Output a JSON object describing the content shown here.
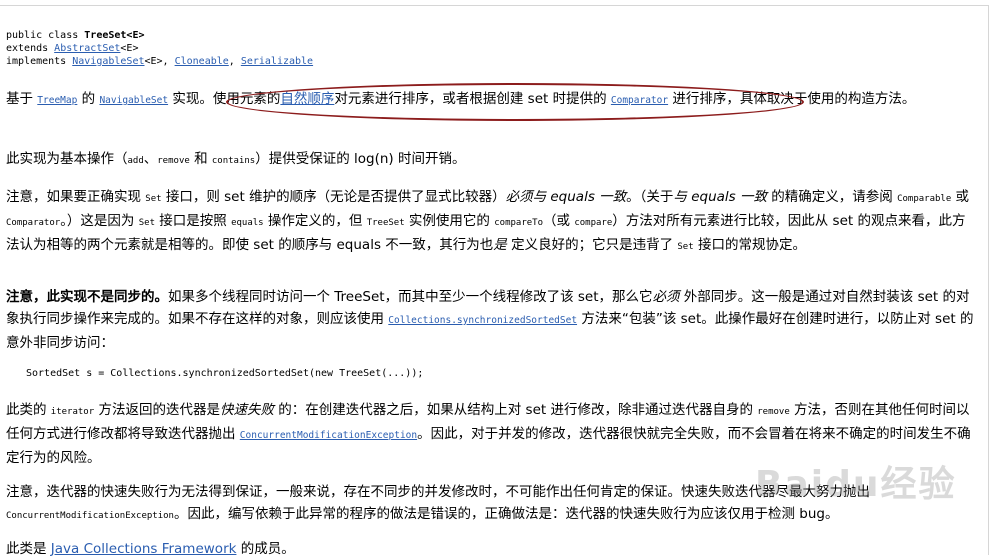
{
  "decl": {
    "l1_prefix": "public class ",
    "class_name": "TreeSet<E>",
    "l2_prefix": "extends ",
    "extends_link": "AbstractSet",
    "extends_suffix": "<E>",
    "l3_prefix": "implements ",
    "impl1": "NavigableSet",
    "impl1_suffix": "<E>, ",
    "impl2": "Cloneable",
    "sep": ", ",
    "impl3": "Serializable"
  },
  "p1": {
    "t1": "基于 ",
    "link_treemap": "TreeMap",
    "t2": " 的 ",
    "link_navigableset": "NavigableSet",
    "t3": " 实现。使用元素的",
    "link_natural": "自然顺序",
    "t4": "对元素进行排序，或者根据创建 set 时提供的 ",
    "link_comparator": "Comparator",
    "t5": " 进行排序，具体取决于使用的构造方法。"
  },
  "p2": {
    "t1": "此实现为基本操作（",
    "c1": "add",
    "t2": "、",
    "c2": "remove",
    "t3": " 和 ",
    "c3": "contains",
    "t4": "）提供受保证的 log(n) 时间开销。"
  },
  "p3": {
    "t1": "注意，如果要正确实现 ",
    "c1": "Set",
    "t2": " 接口，则 set 维护的顺序（无论是否提供了显式比较器）",
    "e1": "必须与 equals 一致",
    "t3": "。（关于",
    "e2": "与 equals 一致",
    "t4": " 的精确定义，请参阅 ",
    "c2": "Comparable",
    "t5": " 或 ",
    "c3": "Comparator",
    "t6": "。）这是因为 ",
    "c4": "Set",
    "t7": " 接口是按照 ",
    "c5": "equals",
    "t8": " 操作定义的，但 ",
    "c6": "TreeSet",
    "t9": " 实例使用它的 ",
    "c7": "compareTo",
    "t10": "（或 ",
    "c8": "compare",
    "t11": "）方法对所有元素进行比较，因此从 set 的观点来看，此方法认为相等的两个元素就是相等的。即使 set 的顺序与 equals 不一致，其行为也",
    "e3": "是",
    "t12": " 定义良好的；它只是违背了 ",
    "c9": "Set",
    "t13": " 接口的常规协定。"
  },
  "p4": {
    "b1": "注意，此实现不是同步的。",
    "t1": "如果多个线程同时访问一个 TreeSet，而其中至少一个线程修改了该 set，那么它",
    "e1": "必须",
    "t2": " 外部同步。这一般是通过对自然封装该 set 的对象执行同步操作来完成的。如果不存在这样的对象，则应该使用 ",
    "link_sync": "Collections.synchronizedSortedSet",
    "t3": " 方法来“包装”该 set。此操作最好在创建时进行，以防止对 set 的意外非同步访问："
  },
  "code_line": "SortedSet s = Collections.synchronizedSortedSet(new TreeSet(...));",
  "p5": {
    "t1": "此类的 ",
    "c1": "iterator",
    "t2": " 方法返回的迭代器是",
    "e1": "快速失败",
    "t3": " 的：在创建迭代器之后，如果从结构上对 set 进行修改，除非通过迭代器自身的 ",
    "c2": "remove",
    "t4": " 方法，否则在其他任何时间以任何方式进行修改都将导致迭代器抛出 ",
    "link_cme": "ConcurrentModificationException",
    "t5": "。因此，对于并发的修改，迭代器很快就完全失败，而不会冒着在将来不确定的时间发生不确定行为的风险。"
  },
  "p6": {
    "t1": "注意，迭代器的快速失败行为无法得到保证，一般来说，存在不同步的并发修改时，不可能作出任何肯定的保证。快速失败迭代器尽最大努力抛出 ",
    "c1": "ConcurrentModificationException",
    "t2": "。因此，编写依赖于此异常的程序的做法是错误的，正确做法是：迭代器的快速失败行为应该仅用于检测 bug。"
  },
  "p7": {
    "t1": "此类是 ",
    "link_jcf": "Java Collections Framework",
    "t2": " 的成员。"
  },
  "watermark": "Baidu经验",
  "colors": {
    "link": "#2a5db0",
    "ellipse": "#8c1c1c"
  }
}
